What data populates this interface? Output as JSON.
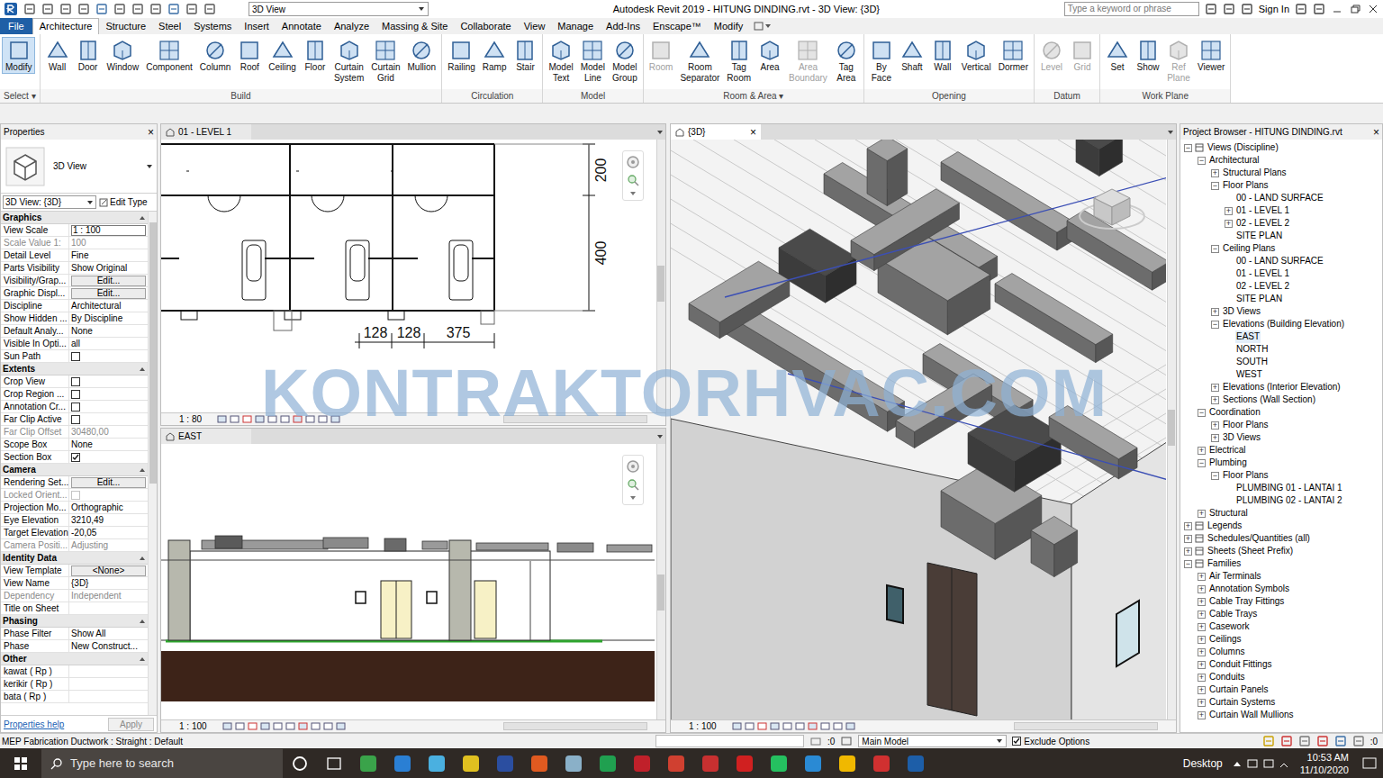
{
  "window": {
    "title": "Autodesk Revit 2019 - HITUNG DINDING.rvt - 3D View: {3D}",
    "view_dropdown": "3D View",
    "search_placeholder": "Type a keyword or phrase",
    "sign_in": "Sign In"
  },
  "ribbon_tabs": [
    {
      "label": "File",
      "selected": false
    },
    {
      "label": "Architecture",
      "selected": true
    },
    {
      "label": "Structure",
      "selected": false
    },
    {
      "label": "Steel",
      "selected": false
    },
    {
      "label": "Systems",
      "selected": false
    },
    {
      "label": "Insert",
      "selected": false
    },
    {
      "label": "Annotate",
      "selected": false
    },
    {
      "label": "Analyze",
      "selected": false
    },
    {
      "label": "Massing & Site",
      "selected": false
    },
    {
      "label": "Collaborate",
      "selected": false
    },
    {
      "label": "View",
      "selected": false
    },
    {
      "label": "Manage",
      "selected": false
    },
    {
      "label": "Add-Ins",
      "selected": false
    },
    {
      "label": "Enscape™",
      "selected": false
    },
    {
      "label": "Modify",
      "selected": false
    }
  ],
  "ribbon_groups": [
    {
      "label": "Select ▾",
      "buttons": [
        {
          "lines": [
            "Modify"
          ],
          "selected": true,
          "disabled": false
        }
      ]
    },
    {
      "label": "Build",
      "buttons": [
        {
          "lines": [
            "Wall"
          ],
          "selected": false,
          "disabled": false
        },
        {
          "lines": [
            "Door"
          ],
          "selected": false,
          "disabled": false
        },
        {
          "lines": [
            "Window"
          ],
          "selected": false,
          "disabled": false
        },
        {
          "lines": [
            "Component"
          ],
          "selected": false,
          "disabled": false
        },
        {
          "lines": [
            "Column"
          ],
          "selected": false,
          "disabled": false
        },
        {
          "lines": [
            "Roof"
          ],
          "selected": false,
          "disabled": false
        },
        {
          "lines": [
            "Ceiling"
          ],
          "selected": false,
          "disabled": false
        },
        {
          "lines": [
            "Floor"
          ],
          "selected": false,
          "disabled": false
        },
        {
          "lines": [
            "Curtain",
            "System"
          ],
          "selected": false,
          "disabled": false
        },
        {
          "lines": [
            "Curtain",
            "Grid"
          ],
          "selected": false,
          "disabled": false
        },
        {
          "lines": [
            "Mullion"
          ],
          "selected": false,
          "disabled": false
        }
      ]
    },
    {
      "label": "Circulation",
      "buttons": [
        {
          "lines": [
            "Railing"
          ],
          "selected": false,
          "disabled": false
        },
        {
          "lines": [
            "Ramp"
          ],
          "selected": false,
          "disabled": false
        },
        {
          "lines": [
            "Stair"
          ],
          "selected": false,
          "disabled": false
        }
      ]
    },
    {
      "label": "Model",
      "buttons": [
        {
          "lines": [
            "Model",
            "Text"
          ],
          "selected": false,
          "disabled": false
        },
        {
          "lines": [
            "Model",
            "Line"
          ],
          "selected": false,
          "disabled": false
        },
        {
          "lines": [
            "Model",
            "Group"
          ],
          "selected": false,
          "disabled": false
        }
      ]
    },
    {
      "label": "Room & Area ▾",
      "buttons": [
        {
          "lines": [
            "Room"
          ],
          "selected": false,
          "disabled": true
        },
        {
          "lines": [
            "Room",
            "Separator"
          ],
          "selected": false,
          "disabled": false
        },
        {
          "lines": [
            "Tag",
            "Room"
          ],
          "selected": false,
          "disabled": false
        },
        {
          "lines": [
            "Area"
          ],
          "selected": false,
          "disabled": false
        },
        {
          "lines": [
            "Area",
            "Boundary"
          ],
          "selected": false,
          "disabled": true
        },
        {
          "lines": [
            "Tag",
            "Area"
          ],
          "selected": false,
          "disabled": false
        }
      ]
    },
    {
      "label": "Opening",
      "buttons": [
        {
          "lines": [
            "By",
            "Face"
          ],
          "selected": false,
          "disabled": false
        },
        {
          "lines": [
            "Shaft"
          ],
          "selected": false,
          "disabled": false
        },
        {
          "lines": [
            "Wall"
          ],
          "selected": false,
          "disabled": false
        },
        {
          "lines": [
            "Vertical"
          ],
          "selected": false,
          "disabled": false
        },
        {
          "lines": [
            "Dormer"
          ],
          "selected": false,
          "disabled": false
        }
      ]
    },
    {
      "label": "Datum",
      "buttons": [
        {
          "lines": [
            "Level"
          ],
          "selected": false,
          "disabled": true
        },
        {
          "lines": [
            "Grid"
          ],
          "selected": false,
          "disabled": true
        }
      ]
    },
    {
      "label": "Work Plane",
      "buttons": [
        {
          "lines": [
            "Set"
          ],
          "selected": false,
          "disabled": false
        },
        {
          "lines": [
            "Show"
          ],
          "selected": false,
          "disabled": false
        },
        {
          "lines": [
            "Ref",
            "Plane"
          ],
          "selected": false,
          "disabled": true
        },
        {
          "lines": [
            "Viewer"
          ],
          "selected": false,
          "disabled": false
        }
      ]
    }
  ],
  "properties": {
    "title": "Properties",
    "close": "×",
    "type_name": "3D View",
    "selector": "3D View: {3D}",
    "edit_type": "Edit Type",
    "help": "Properties help",
    "apply": "Apply",
    "rows": [
      {
        "kind": "section",
        "label": "Graphics"
      },
      {
        "kind": "input",
        "label": "View Scale",
        "value": "1 : 100",
        "disabled": false
      },
      {
        "kind": "text",
        "label": "Scale Value 1:",
        "value": "100",
        "disabled": true
      },
      {
        "kind": "text",
        "label": "Detail Level",
        "value": "Fine",
        "disabled": false
      },
      {
        "kind": "text",
        "label": "Parts Visibility",
        "value": "Show Original",
        "disabled": false
      },
      {
        "kind": "button",
        "label": "Visibility/Grap...",
        "value": "Edit...",
        "disabled": false
      },
      {
        "kind": "button",
        "label": "Graphic Displ...",
        "value": "Edit...",
        "disabled": false
      },
      {
        "kind": "text",
        "label": "Discipline",
        "value": "Architectural",
        "disabled": false
      },
      {
        "kind": "text",
        "label": "Show Hidden ...",
        "value": "By Discipline",
        "disabled": false
      },
      {
        "kind": "text",
        "label": "Default Analy...",
        "value": "None",
        "disabled": false
      },
      {
        "kind": "text",
        "label": "Visible In Opti...",
        "value": "all",
        "disabled": false
      },
      {
        "kind": "check",
        "label": "Sun Path",
        "checked": false,
        "disabled": false
      },
      {
        "kind": "section",
        "label": "Extents"
      },
      {
        "kind": "check",
        "label": "Crop View",
        "checked": false,
        "disabled": false
      },
      {
        "kind": "check",
        "label": "Crop Region ...",
        "checked": false,
        "disabled": false
      },
      {
        "kind": "check",
        "label": "Annotation Cr...",
        "checked": false,
        "disabled": false
      },
      {
        "kind": "check",
        "label": "Far Clip Active",
        "checked": false,
        "disabled": false
      },
      {
        "kind": "text",
        "label": "Far Clip Offset",
        "value": "30480,00",
        "disabled": true
      },
      {
        "kind": "text",
        "label": "Scope Box",
        "value": "None",
        "disabled": false
      },
      {
        "kind": "check",
        "label": "Section Box",
        "checked": true,
        "disabled": false
      },
      {
        "kind": "section",
        "label": "Camera"
      },
      {
        "kind": "button",
        "label": "Rendering Set...",
        "value": "Edit...",
        "disabled": false
      },
      {
        "kind": "check",
        "label": "Locked Orient...",
        "checked": false,
        "disabled": true
      },
      {
        "kind": "text",
        "label": "Projection Mo...",
        "value": "Orthographic",
        "disabled": false
      },
      {
        "kind": "text",
        "label": "Eye Elevation",
        "value": "3210,49",
        "disabled": false
      },
      {
        "kind": "text",
        "label": "Target Elevation",
        "value": "-20,05",
        "disabled": false
      },
      {
        "kind": "text",
        "label": "Camera Positi...",
        "value": "Adjusting",
        "disabled": true
      },
      {
        "kind": "section",
        "label": "Identity Data"
      },
      {
        "kind": "button",
        "label": "View Template",
        "value": "<None>",
        "disabled": false
      },
      {
        "kind": "text",
        "label": "View Name",
        "value": "{3D}",
        "disabled": false
      },
      {
        "kind": "text",
        "label": "Dependency",
        "value": "Independent",
        "disabled": true
      },
      {
        "kind": "text",
        "label": "Title on Sheet",
        "value": "",
        "disabled": false
      },
      {
        "kind": "section",
        "label": "Phasing"
      },
      {
        "kind": "text",
        "label": "Phase Filter",
        "value": "Show All",
        "disabled": false
      },
      {
        "kind": "text",
        "label": "Phase",
        "value": "New Construct...",
        "disabled": false
      },
      {
        "kind": "section",
        "label": "Other"
      },
      {
        "kind": "text",
        "label": "kawat ( Rp )",
        "value": "",
        "disabled": false
      },
      {
        "kind": "text",
        "label": "kerikir ( Rp )",
        "value": "",
        "disabled": false
      },
      {
        "kind": "text",
        "label": "bata ( Rp )",
        "value": "",
        "disabled": false
      }
    ]
  },
  "plan_view": {
    "title": "01 - LEVEL 1",
    "scale": "1 : 80",
    "active": false,
    "dimensions": {
      "vertical": [
        "200",
        "400"
      ],
      "horizontal": [
        "128",
        "128",
        "375"
      ]
    }
  },
  "elevation_view": {
    "title": "EAST",
    "scale": "1 : 100",
    "active": false
  },
  "view_3d": {
    "title": "{3D}",
    "close": "×",
    "scale": "1 : 100",
    "active": true
  },
  "watermark": "KONTRAKTORHVAC.COM",
  "project_browser": {
    "title": "Project Browser - HITUNG DINDING.rvt",
    "close": "×",
    "items": [
      {
        "label": "Views (Discipline)",
        "depth": 0,
        "toggle": "−",
        "selected": false
      },
      {
        "label": "Architectural",
        "depth": 1,
        "toggle": "−",
        "selected": false
      },
      {
        "label": "Structural Plans",
        "depth": 2,
        "toggle": "+",
        "selected": false
      },
      {
        "label": "Floor Plans",
        "depth": 2,
        "toggle": "−",
        "selected": false
      },
      {
        "label": "00 - LAND SURFACE",
        "depth": 3,
        "toggle": "",
        "selected": false
      },
      {
        "label": "01 - LEVEL 1",
        "depth": 3,
        "toggle": "+",
        "selected": false
      },
      {
        "label": "02 - LEVEL 2",
        "depth": 3,
        "toggle": "+",
        "selected": false
      },
      {
        "label": "SITE PLAN",
        "depth": 3,
        "toggle": "",
        "selected": false
      },
      {
        "label": "Ceiling Plans",
        "depth": 2,
        "toggle": "−",
        "selected": false
      },
      {
        "label": "00 - LAND SURFACE",
        "depth": 3,
        "toggle": "",
        "selected": false
      },
      {
        "label": "01 - LEVEL 1",
        "depth": 3,
        "toggle": "",
        "selected": false
      },
      {
        "label": "02 - LEVEL 2",
        "depth": 3,
        "toggle": "",
        "selected": false
      },
      {
        "label": "SITE PLAN",
        "depth": 3,
        "toggle": "",
        "selected": false
      },
      {
        "label": "3D Views",
        "depth": 2,
        "toggle": "+",
        "selected": false
      },
      {
        "label": "Elevations (Building Elevation)",
        "depth": 2,
        "toggle": "−",
        "selected": false
      },
      {
        "label": "EAST",
        "depth": 3,
        "toggle": "",
        "selected": true
      },
      {
        "label": "NORTH",
        "depth": 3,
        "toggle": "",
        "selected": false
      },
      {
        "label": "SOUTH",
        "depth": 3,
        "toggle": "",
        "selected": false
      },
      {
        "label": "WEST",
        "depth": 3,
        "toggle": "",
        "selected": false
      },
      {
        "label": "Elevations (Interior Elevation)",
        "depth": 2,
        "toggle": "+",
        "selected": false
      },
      {
        "label": "Sections (Wall Section)",
        "depth": 2,
        "toggle": "+",
        "selected": false
      },
      {
        "label": "Coordination",
        "depth": 1,
        "toggle": "−",
        "selected": false
      },
      {
        "label": "Floor Plans",
        "depth": 2,
        "toggle": "+",
        "selected": false
      },
      {
        "label": "3D Views",
        "depth": 2,
        "toggle": "+",
        "selected": false
      },
      {
        "label": "Electrical",
        "depth": 1,
        "toggle": "+",
        "selected": false
      },
      {
        "label": "Plumbing",
        "depth": 1,
        "toggle": "−",
        "selected": false
      },
      {
        "label": "Floor Plans",
        "depth": 2,
        "toggle": "−",
        "selected": false
      },
      {
        "label": "PLUMBING 01 - LANTAI 1",
        "depth": 3,
        "toggle": "",
        "selected": false
      },
      {
        "label": "PLUMBING 02 - LANTAI 2",
        "depth": 3,
        "toggle": "",
        "selected": false
      },
      {
        "label": "Structural",
        "depth": 1,
        "toggle": "+",
        "selected": false
      },
      {
        "label": "Legends",
        "depth": 0,
        "toggle": "+",
        "selected": false
      },
      {
        "label": "Schedules/Quantities (all)",
        "depth": 0,
        "toggle": "+",
        "selected": false
      },
      {
        "label": "Sheets (Sheet Prefix)",
        "depth": 0,
        "toggle": "+",
        "selected": false
      },
      {
        "label": "Families",
        "depth": 0,
        "toggle": "−",
        "selected": false
      },
      {
        "label": "Air Terminals",
        "depth": 1,
        "toggle": "+",
        "selected": false
      },
      {
        "label": "Annotation Symbols",
        "depth": 1,
        "toggle": "+",
        "selected": false
      },
      {
        "label": "Cable Tray Fittings",
        "depth": 1,
        "toggle": "+",
        "selected": false
      },
      {
        "label": "Cable Trays",
        "depth": 1,
        "toggle": "+",
        "selected": false
      },
      {
        "label": "Casework",
        "depth": 1,
        "toggle": "+",
        "selected": false
      },
      {
        "label": "Ceilings",
        "depth": 1,
        "toggle": "+",
        "selected": false
      },
      {
        "label": "Columns",
        "depth": 1,
        "toggle": "+",
        "selected": false
      },
      {
        "label": "Conduit Fittings",
        "depth": 1,
        "toggle": "+",
        "selected": false
      },
      {
        "label": "Conduits",
        "depth": 1,
        "toggle": "+",
        "selected": false
      },
      {
        "label": "Curtain Panels",
        "depth": 1,
        "toggle": "+",
        "selected": false
      },
      {
        "label": "Curtain Systems",
        "depth": 1,
        "toggle": "+",
        "selected": false
      },
      {
        "label": "Curtain Wall Mullions",
        "depth": 1,
        "toggle": "+",
        "selected": false
      }
    ]
  },
  "status_bar": {
    "text": "MEP Fabrication Ductwork : Straight : Default",
    "filter_count": ":0",
    "workset": "Main Model",
    "exclude_options": {
      "label": "Exclude Options",
      "checked": true
    },
    "filter_count_right": ":0"
  },
  "taskbar": {
    "search_placeholder": "Type here to search",
    "desktop": "Desktop",
    "time": "10:53 AM",
    "date": "11/10/2020"
  }
}
